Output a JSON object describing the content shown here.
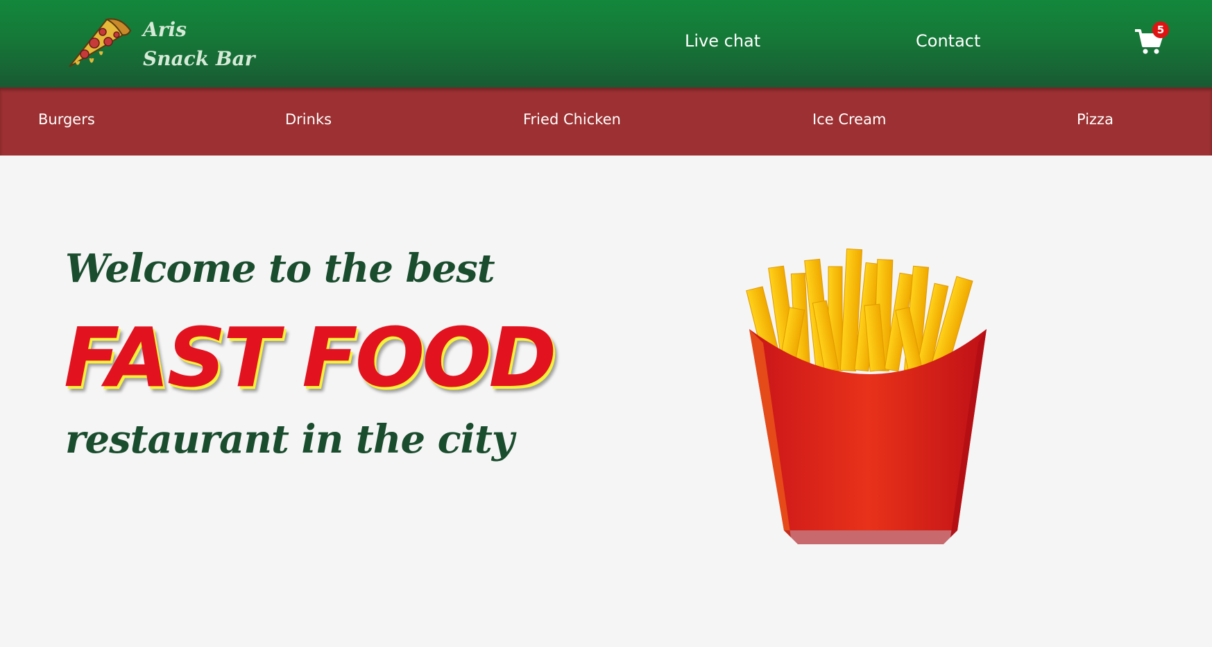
{
  "brand": {
    "line1": "Aris",
    "line2": "Snack Bar",
    "logo_icon": "pizza-slice-icon"
  },
  "header_nav": {
    "live_chat": "Live chat",
    "contact": "Contact"
  },
  "cart": {
    "icon": "shopping-cart-icon",
    "count": "5"
  },
  "categories": [
    {
      "label": "Burgers"
    },
    {
      "label": "Drinks"
    },
    {
      "label": "Fried Chicken"
    },
    {
      "label": "Ice Cream"
    },
    {
      "label": "Pizza"
    }
  ],
  "hero": {
    "line1": "Welcome to the best",
    "highlight": "FAST FOOD",
    "line3": "restaurant in the city",
    "image_icon": "french-fries-illustration"
  },
  "colors": {
    "header_green": "#157a38",
    "category_bar": "#9c3032",
    "hero_text_green": "#1a4d2e",
    "highlight_red": "#e3121f",
    "highlight_yellow": "#f7f23a",
    "badge_red": "#e01313",
    "background": "#f5f5f5"
  }
}
